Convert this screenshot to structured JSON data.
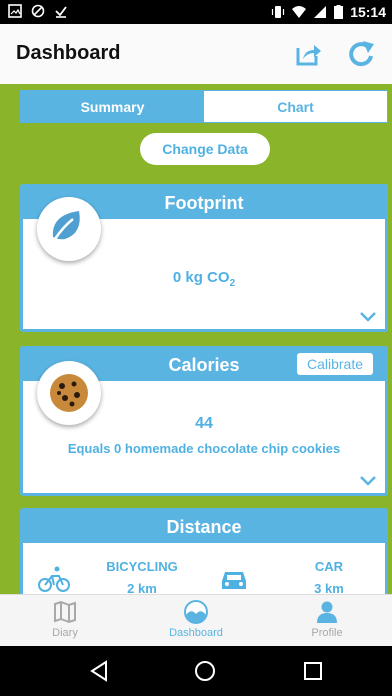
{
  "status_bar": {
    "time": "15:14"
  },
  "app_bar": {
    "title": "Dashboard"
  },
  "segments": {
    "summary": "Summary",
    "chart": "Chart"
  },
  "change_data": "Change Data",
  "footprint": {
    "title": "Footprint",
    "value_number": "0 kg CO",
    "value_sub": "2"
  },
  "calories": {
    "title": "Calories",
    "calibrate": "Calibrate",
    "value": "44",
    "equals": "Equals 0 homemade chocolate chip cookies"
  },
  "distance": {
    "title": "Distance",
    "modes": [
      {
        "name": "BICYCLING",
        "value": "2 km"
      },
      {
        "name": "CAR",
        "value": "3 km"
      }
    ]
  },
  "tabs": {
    "diary": "Diary",
    "dashboard": "Dashboard",
    "profile": "Profile"
  },
  "colors": {
    "accent": "#5ab4e2",
    "green": "#8ab52a"
  }
}
